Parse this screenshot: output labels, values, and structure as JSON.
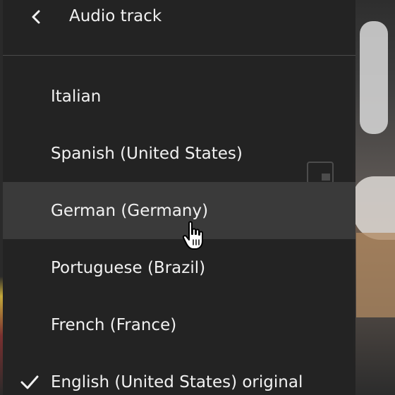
{
  "menu": {
    "title": "Audio track",
    "back_icon": "chevron-left-icon",
    "items": [
      {
        "label": "Italian",
        "selected": false,
        "hovered": false
      },
      {
        "label": "Spanish (United States)",
        "selected": false,
        "hovered": false
      },
      {
        "label": "German (Germany)",
        "selected": false,
        "hovered": true
      },
      {
        "label": "Portuguese (Brazil)",
        "selected": false,
        "hovered": false
      },
      {
        "label": "French (France)",
        "selected": false,
        "hovered": false
      },
      {
        "label": "English (United States) original",
        "selected": true,
        "hovered": false
      }
    ],
    "selected_icon": "checkmark-icon"
  },
  "colors": {
    "menu_background": "#232323",
    "hover_background": "#3a3a3a",
    "text": "#f1f1f1",
    "divider": "#4a4a4a"
  }
}
